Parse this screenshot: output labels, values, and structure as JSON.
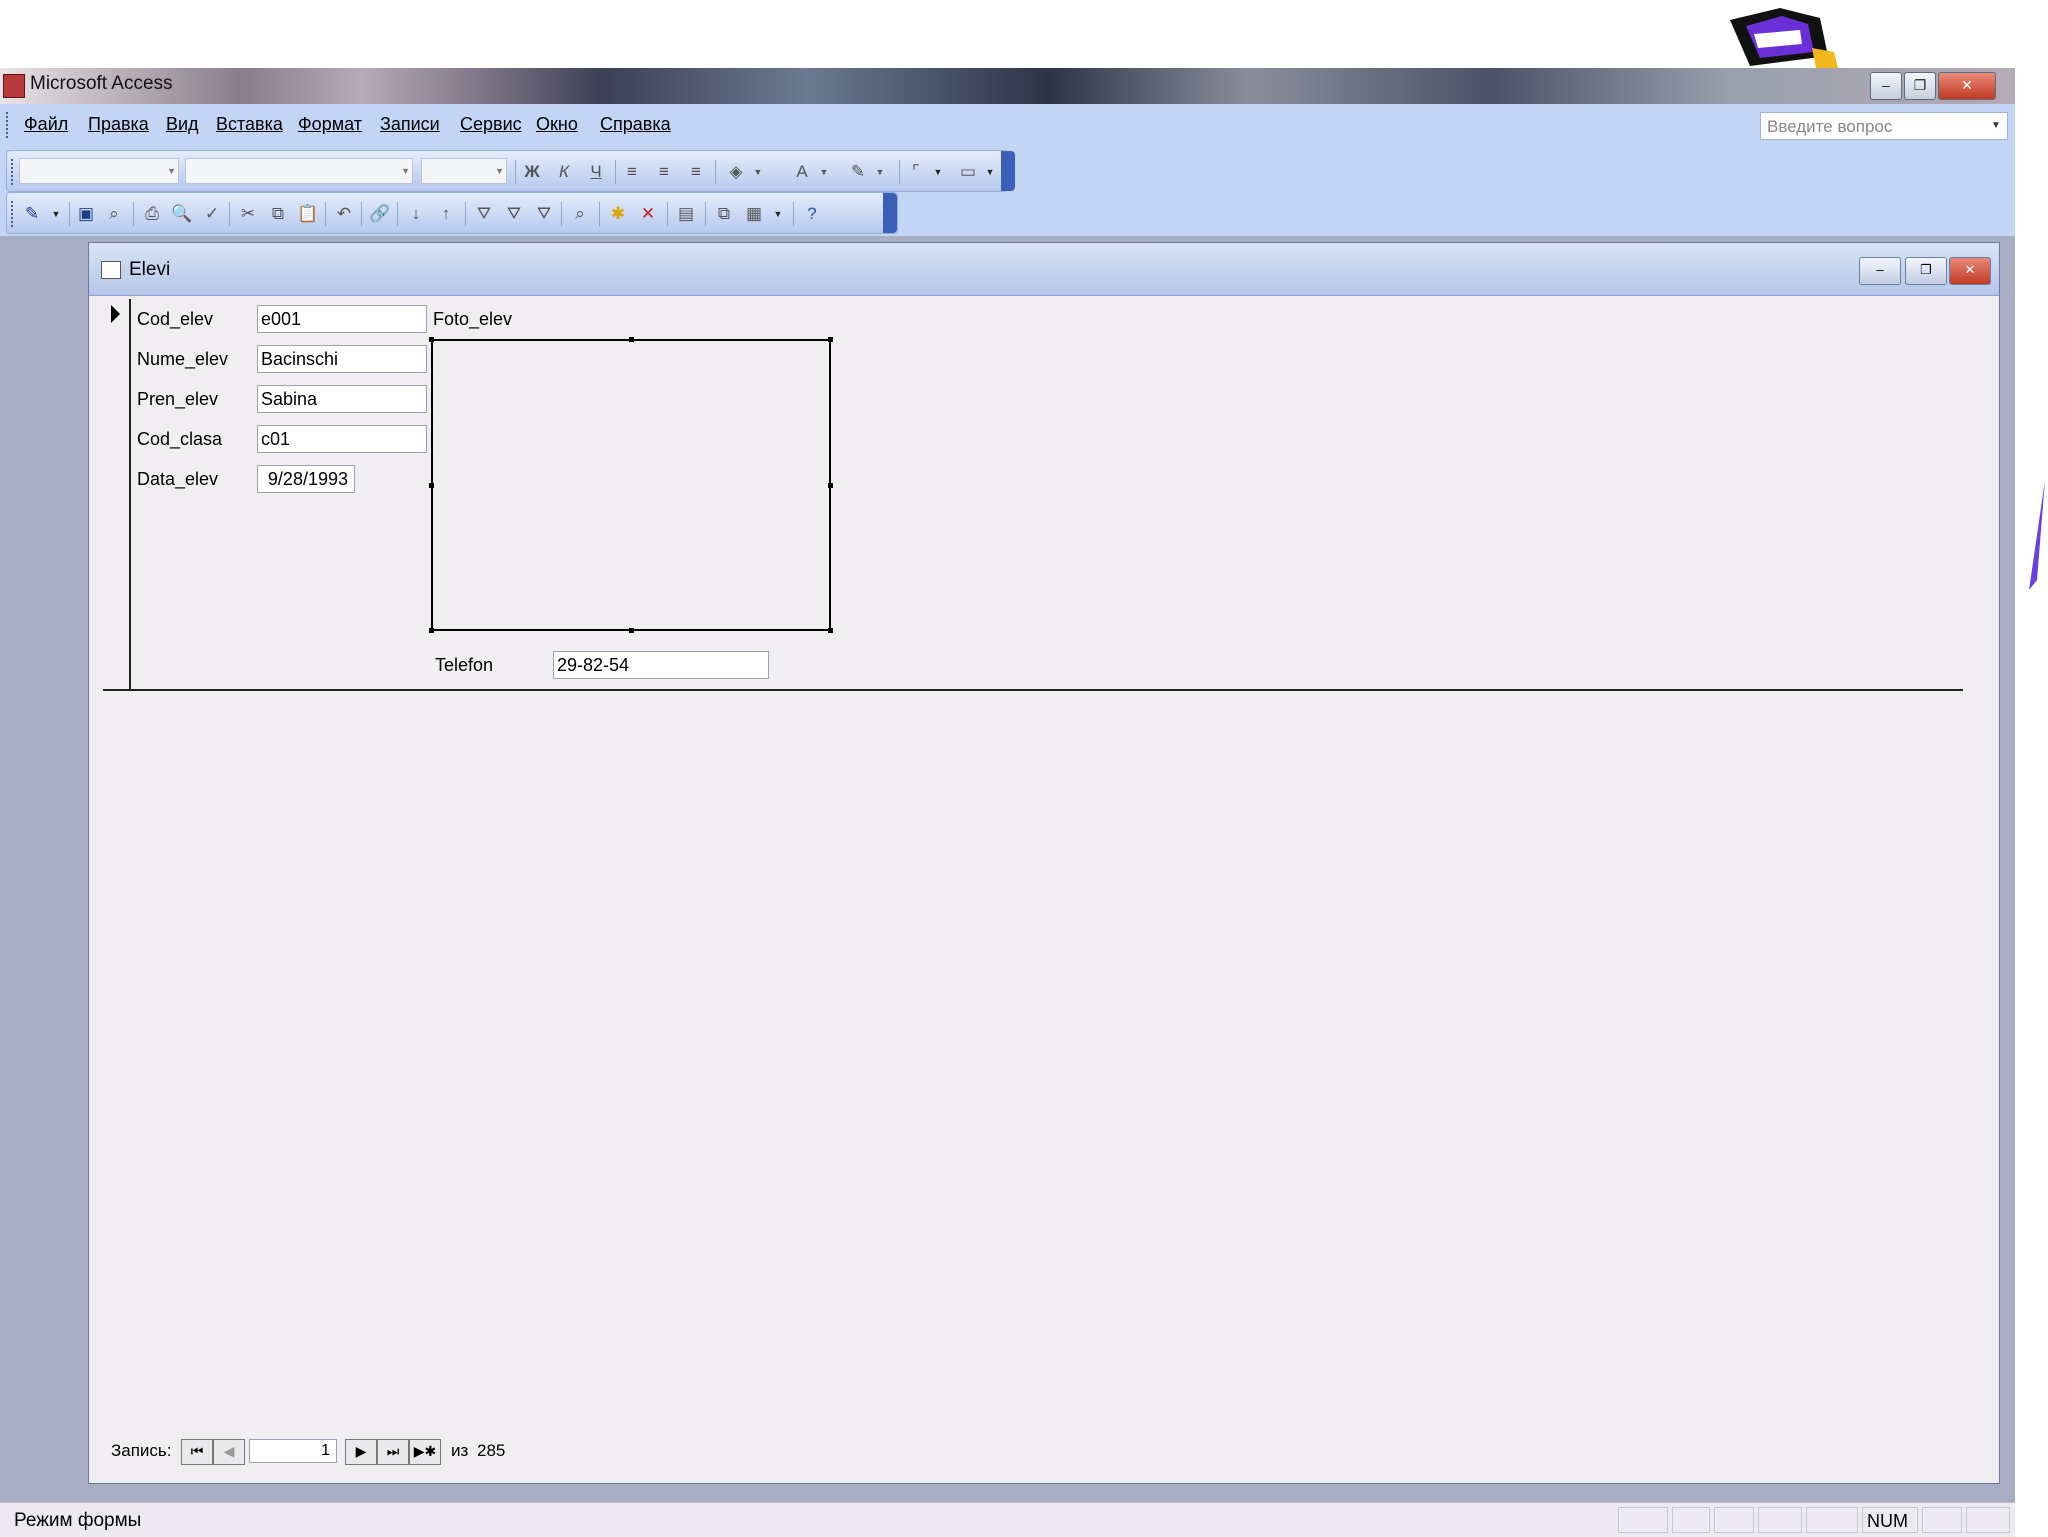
{
  "window": {
    "title": "Microsoft Access",
    "controls": {
      "minimize": "–",
      "restore": "❐",
      "close": "✕"
    }
  },
  "menu": {
    "items": [
      {
        "id": "file",
        "label": "Файл"
      },
      {
        "id": "edit",
        "label": "Правка"
      },
      {
        "id": "view",
        "label": "Вид"
      },
      {
        "id": "insert",
        "label": "Вставка"
      },
      {
        "id": "format",
        "label": "Формат"
      },
      {
        "id": "records",
        "label": "Записи"
      },
      {
        "id": "service",
        "label": "Сервис"
      },
      {
        "id": "window",
        "label": "Окно"
      },
      {
        "id": "help",
        "label": "Справка"
      }
    ],
    "ask_placeholder": "Введите вопрос"
  },
  "toolbar": {
    "bold": "Ж",
    "italic": "К",
    "underline": "Ч",
    "font_color": "A"
  },
  "document": {
    "title": "Elevi"
  },
  "form": {
    "fields": [
      {
        "label": "Cod_elev",
        "value": "e001"
      },
      {
        "label": "Nume_elev",
        "value": "Bacinschi"
      },
      {
        "label": "Pren_elev",
        "value": "Sabina"
      },
      {
        "label": "Cod_clasa",
        "value": "c01"
      },
      {
        "label": "Data_elev",
        "value": "9/28/1993"
      }
    ],
    "photo_label": "Foto_elev",
    "phone": {
      "label": "Telefon",
      "value": "29-82-54"
    }
  },
  "navigator": {
    "label": "Запись:",
    "current": "1",
    "of_label": "из",
    "total": "285"
  },
  "statusbar": {
    "mode": "Режим формы",
    "num": "NUM"
  },
  "colors": {
    "command_bar": "#c3d5f5",
    "mdi_background": "#a7aec4",
    "form_background": "#f0eef0",
    "close_button": "#c23a22"
  }
}
